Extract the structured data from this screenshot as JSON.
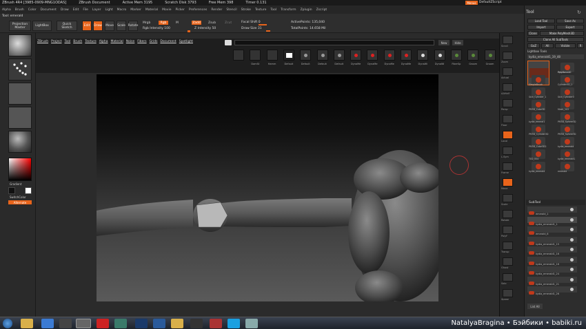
{
  "titlebar": {
    "app": "ZBrush 4R4 [3985-0909-MNG1ODAS]",
    "doc": "ZBrush Document",
    "active_mem": "Active Mem 3195",
    "scratch_disk": "Scratch Disk 3793",
    "free_mem": "Free Mem 398",
    "timer": "Timer 0.131",
    "menus_btn": "Menus",
    "default_script": "DefaultZScript"
  },
  "menubar": [
    "Alpha",
    "Brush",
    "Color",
    "Document",
    "Draw",
    "Edit",
    "File",
    "Layer",
    "Light",
    "Macro",
    "Marker",
    "Material",
    "Movie",
    "Picker",
    "Preferences",
    "Render",
    "Stencil",
    "Stroke",
    "Texture",
    "Tool",
    "Transform",
    "Zplugin",
    "Zscript"
  ],
  "topbar": {
    "toolname": "Tool: emerald",
    "projection_master": "Projection Master",
    "lightbox": "LightBox",
    "quick_sketch": "Quick Sketch",
    "edit": "Edit",
    "draw": "Draw",
    "move": "Move",
    "scale": "Scale",
    "rotate": "Rotate",
    "mrgb": "Mrgb",
    "rgb": "Rgb",
    "m": "M",
    "rgb_intensity": "Rgb Intensity 100",
    "zadd": "Zadd",
    "zsub": "Zsub",
    "zcut": "Zcut",
    "z_intensity": "Z Intensity 50",
    "focal_shift": "Focal Shift 0",
    "draw_size": "Draw Size 31",
    "active_points": "ActivePoints: 135,040",
    "total_points": "TotalPoints: 14.658 Mil"
  },
  "leftshelf": {
    "gradient": "Gradient",
    "switchcolor": "SwitchColor",
    "alternate": "Alternate"
  },
  "navlinks": [
    "ZBrush",
    "Project",
    "Tool",
    "Brush",
    "Texture",
    "Alpha",
    "Material",
    "Noise",
    "Fibers",
    "Grids",
    "Document",
    "Spotlight"
  ],
  "brushes": [
    "",
    "DamSt",
    "Hamm",
    "Default",
    "Default",
    "Default",
    "Default",
    "DynaMe",
    "DynaMe",
    "DynaMe",
    "DynaMe",
    "DynaWi",
    "DynaWi",
    "FiberSp",
    "Groom",
    "Groom"
  ],
  "brush_header": {
    "new": "New",
    "hide": "Hide"
  },
  "rightstrip": [
    "Scroll",
    "Zoom",
    "Actual",
    "AAHalf",
    "Persp",
    "Floor",
    "Local",
    "L.Sym",
    "Frame",
    "Move",
    "Scale",
    "Rotate",
    "PolyF",
    "Transp",
    "Ghost",
    "Solo",
    "Xpose"
  ],
  "rightpanel": {
    "title": "Tool",
    "load_tool": "Load Tool",
    "save_as": "Save As",
    "import": "Import",
    "export": "Export",
    "clone": "Clone",
    "make_polymesh": "Make PolyMesh3D",
    "clone_all": "Clone All SubTools",
    "goz": "GoZ",
    "all": "All",
    "visible": "Visible",
    "r": "R",
    "lightbox_tools": "Lightbox Tools",
    "current_tool": "kydia_emerald1_19_48",
    "tools": [
      "kydia_emera",
      "Cylinder3D",
      "PolyMesh3D",
      "SimpleBrush",
      "Cylinder3D_1",
      "Skin_Cylinder_1",
      "Skin_Cylinder0",
      "PM3D_Cube3D",
      "Mesh_103",
      "kydia_emeral1",
      "PM3D_Sphere3D",
      "PM3D_Cylinder3D",
      "PM3D_Sphere3D",
      "PM3D_Cube3D2",
      "kydia_emerald",
      "TED_004",
      "kydia_emerald1",
      "kydia_emerald",
      "emerald"
    ],
    "subtool": "SubTool",
    "subtools": [
      "emerald_1",
      "kydia_emerald1_1",
      "emerald_6",
      "kydia_emerald1_15",
      "kydia_emerald1_16",
      "kydia_emerald1_16",
      "kydia_emerald1_24",
      "kydia_emerald1_21",
      "kydia_emerald1_26"
    ],
    "list_all": "List All"
  },
  "watermark": "NatalyaBragina • Бэйбики • babiki.ru",
  "colors": {
    "accent": "#e8641b"
  }
}
